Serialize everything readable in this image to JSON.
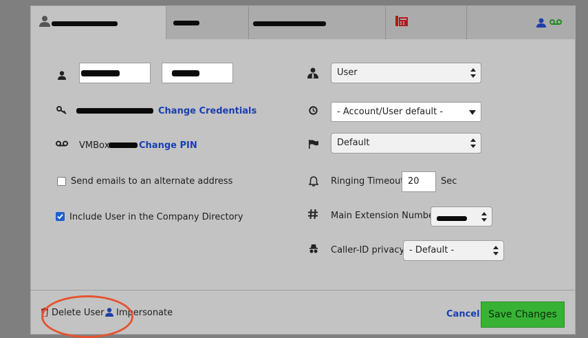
{
  "form": {
    "credentials_link": "Change Credentials",
    "vmbox_prefix": "VMBox",
    "change_pin_link": "Change PIN",
    "alt_email_label": "Send emails to an alternate address",
    "alt_email_checked": false,
    "directory_label": "Include User in the Company Directory",
    "directory_checked": true,
    "role_select": "User",
    "timezone_select": "- Account/User default -",
    "language_select": "Default",
    "ringing_timeout_label": "Ringing Timeout",
    "ringing_timeout_value": "20",
    "ringing_timeout_unit": "Sec",
    "main_extension_label": "Main Extension Number",
    "caller_id_label": "Caller-ID privacy",
    "caller_id_select": "- Default -"
  },
  "footer": {
    "delete_label": "Delete User",
    "impersonate_label": "Impersonate",
    "cancel_label": "Cancel",
    "save_label": "Save Changes"
  },
  "colors": {
    "link": "#1a3fb0",
    "save_button": "#37b234",
    "highlight_circle": "#e5532f",
    "checkbox_checked": "#1f5fd0"
  },
  "icons": {
    "user": "user-icon",
    "key": "key-icon",
    "voicemail": "voicemail-icon",
    "role": "user-tie-icon",
    "timezone": "clock-icon",
    "language": "flag-icon",
    "ringing": "bell-icon",
    "extension": "hash-icon",
    "caller_id": "incognito-icon",
    "phone": "desk-phone-icon",
    "delete": "trash-icon"
  }
}
